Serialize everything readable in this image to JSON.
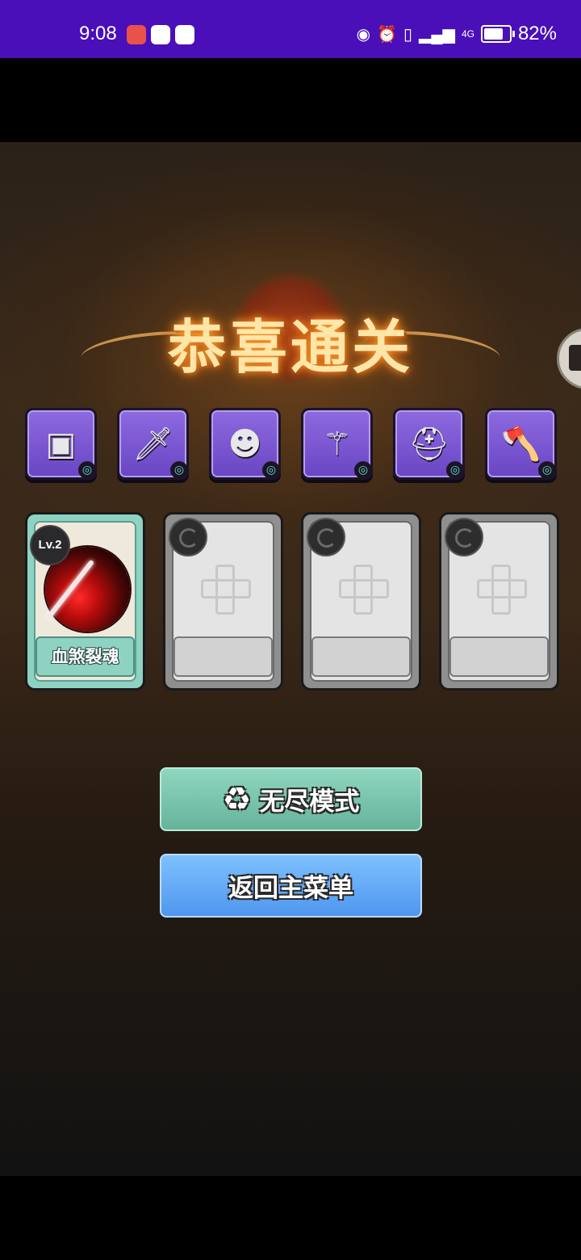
{
  "status_bar": {
    "time": "9:08",
    "battery_percent": "82%",
    "battery_level": 0.82,
    "network": "4G",
    "apps": [
      {
        "icon": "huawei-app-icon",
        "color": "#e8524a"
      },
      {
        "icon": "shield-app-icon",
        "color": "#ffffff"
      },
      {
        "icon": "browser-app-icon",
        "color": "#ffffff"
      }
    ],
    "indicators": [
      "eye-icon",
      "alarm-icon",
      "vibrate-icon",
      "signal-icon",
      "signal-4g-icon",
      "battery-icon"
    ]
  },
  "game": {
    "title": "恭喜通关",
    "items": [
      {
        "icon": "stone-tablet-icon",
        "glyph": "▣"
      },
      {
        "icon": "dagger-icon",
        "glyph": "🗡"
      },
      {
        "icon": "demon-mask-icon",
        "glyph": "☻"
      },
      {
        "icon": "fire-staff-icon",
        "glyph": "⚚"
      },
      {
        "icon": "scholar-hat-icon",
        "glyph": "⛑"
      },
      {
        "icon": "battle-axe-icon",
        "glyph": "🪓"
      }
    ],
    "skill_cards": [
      {
        "state": "filled",
        "level": "Lv.2",
        "name": "血煞裂魂",
        "icon": "blood-slash-skill-icon"
      },
      {
        "state": "empty",
        "icon": "plus-icon"
      },
      {
        "state": "empty",
        "icon": "plus-icon"
      },
      {
        "state": "empty",
        "icon": "plus-icon"
      }
    ],
    "buttons": {
      "endless_label": "无尽模式",
      "main_menu_label": "返回主菜单"
    },
    "colors": {
      "status_bar": "#4a0fb8",
      "item_frame": "#7a55d2",
      "active_card": "#8ed3c2",
      "endless_button": "#7cc7b0",
      "menu_button": "#62a9f5"
    }
  }
}
